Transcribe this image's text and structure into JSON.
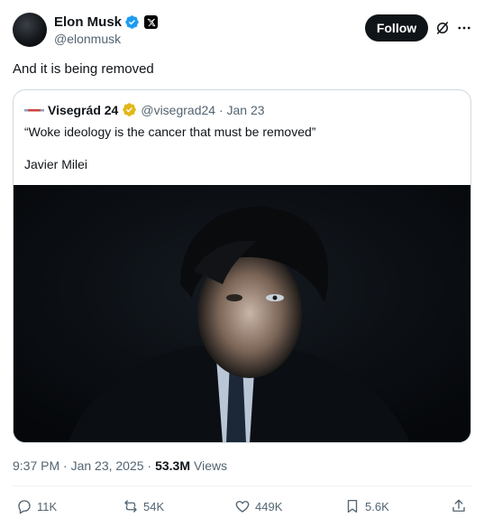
{
  "author": {
    "name": "Elon Musk",
    "handle": "@elonmusk",
    "follow_label": "Follow"
  },
  "tweet": {
    "text": "And it is being removed"
  },
  "quote": {
    "name": "Visegrád 24",
    "handle_date": "@visegrad24 · Jan 23",
    "text": "“Woke ideology is the cancer that must be removed”",
    "attribution": "Javier Milei"
  },
  "meta": {
    "time_date": "9:37 PM · Jan 23, 2025 ·",
    "views_count": "53.3M",
    "views_label": "Views"
  },
  "actions": {
    "replies": "11K",
    "reposts": "54K",
    "likes": "449K",
    "bookmarks": "5.6K"
  },
  "colors": {
    "verified_blue": "#1d9bf0",
    "verified_gold": "#e2b719",
    "text_primary": "#0f1419",
    "text_secondary": "#536471"
  },
  "icons": [
    "verified-badge-icon",
    "x-logo-icon",
    "grok-icon",
    "more-icon",
    "reply-icon",
    "repost-icon",
    "like-icon",
    "bookmark-icon",
    "share-icon"
  ]
}
